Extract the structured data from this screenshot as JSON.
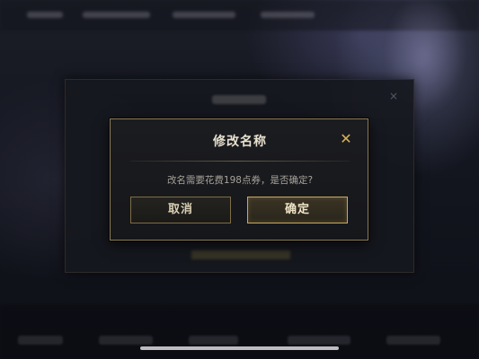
{
  "dialog": {
    "title": "修改名称",
    "message": "改名需要花费198点券，是否确定?",
    "cancel_label": "取消",
    "confirm_label": "确定",
    "close_glyph": "✕"
  },
  "colors": {
    "accent_gold": "#c8a85e",
    "border_gold": "#8a7b55",
    "dialog_bg": "#1b1c20",
    "title_text": "#e8e1cf",
    "message_text": "#a7a39a"
  },
  "icons": {
    "close": "close-icon"
  }
}
